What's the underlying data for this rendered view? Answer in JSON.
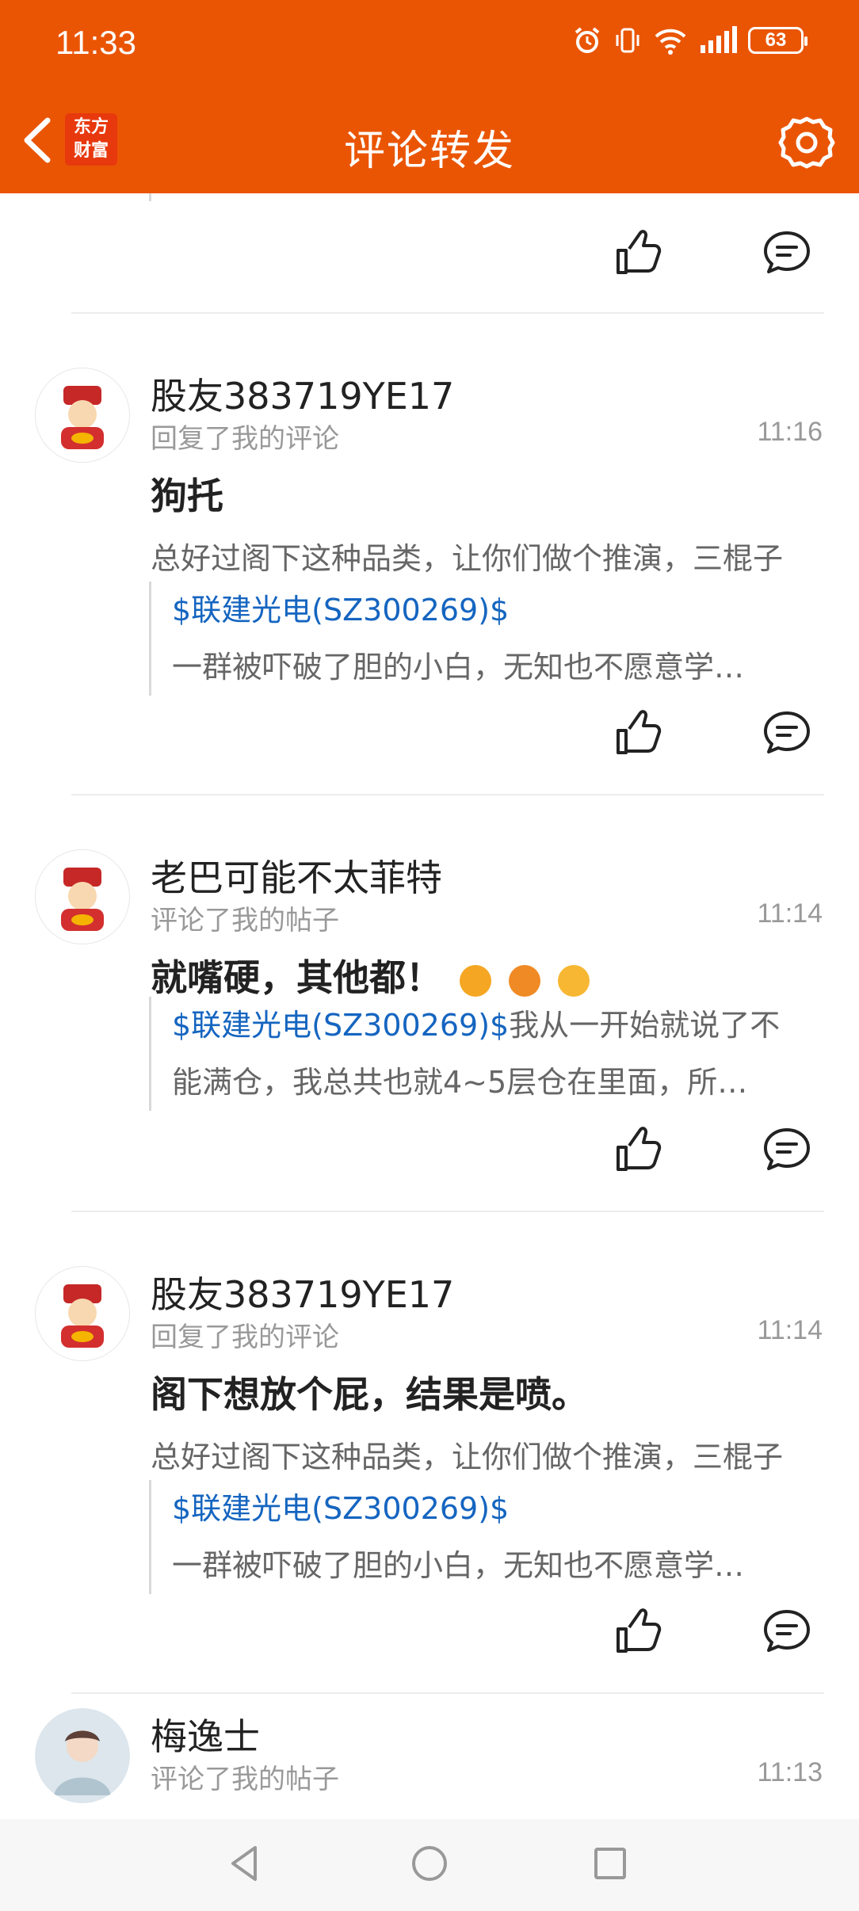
{
  "status_bar": {
    "time": "11:33",
    "battery": "63"
  },
  "header": {
    "title": "评论转发",
    "logo_line1": "东方",
    "logo_line2": "财富"
  },
  "items": [
    {
      "user": "股友383719YE17",
      "action": "回复了我的评论",
      "time": "11:16",
      "comment": "狗托",
      "preview": "总好过阁下这种品类，让你们做个推演，三棍子",
      "quote_stock": "$联建光电(SZ300269)$",
      "quote_line2": "一群被吓破了胆的小白，无知也不愿意学…"
    },
    {
      "user": "老巴可能不太菲特",
      "action": "评论了我的帖子",
      "time": "11:14",
      "comment": "就嘴硬，其他都！",
      "quote_stock": "$联建光电(SZ300269)$",
      "quote_rest": "我从一开始就说了不",
      "quote_line2": "能满仓，我总共也就4~5层仓在里面，所…"
    },
    {
      "user": "股友383719YE17",
      "action": "回复了我的评论",
      "time": "11:14",
      "comment": "阁下想放个屁，结果是喷。",
      "preview": "总好过阁下这种品类，让你们做个推演，三棍子",
      "quote_stock": "$联建光电(SZ300269)$",
      "quote_line2": "一群被吓破了胆的小白，无知也不愿意学…"
    },
    {
      "user": "梅逸士",
      "action": "评论了我的帖子",
      "time": "11:13"
    }
  ],
  "icons": {
    "back": "chevron-left-icon",
    "settings": "gear-icon",
    "like": "thumbs-up-icon",
    "reply": "comment-bubble-icon"
  },
  "colors": {
    "brand": "#EA5504",
    "link": "#1565C0"
  }
}
